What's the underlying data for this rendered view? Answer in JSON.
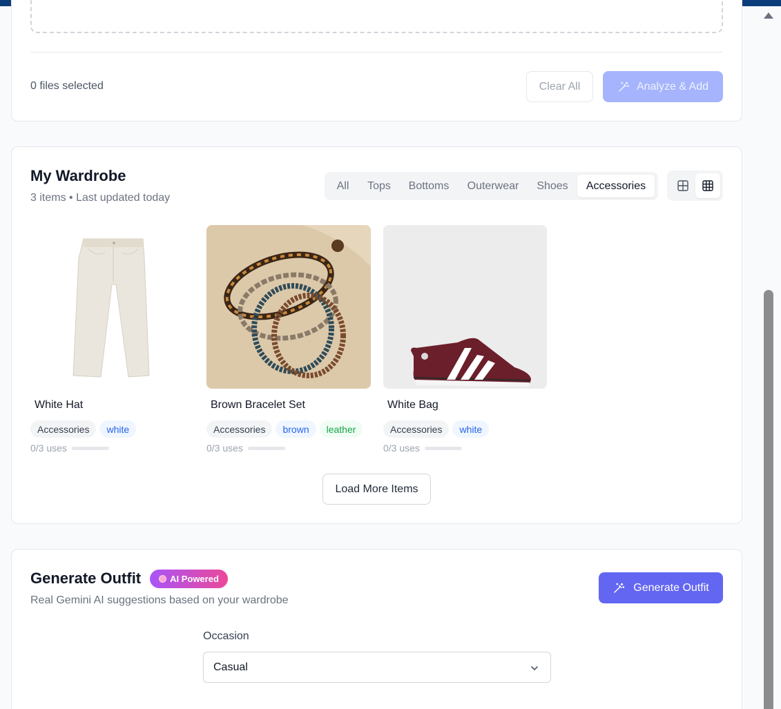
{
  "upload": {
    "files_selected": "0 files selected",
    "clear_label": "Clear All",
    "analyze_label": "Analyze & Add"
  },
  "wardrobe": {
    "title": "My Wardrobe",
    "subtitle": "3 items • Last updated today",
    "filters": [
      "All",
      "Tops",
      "Bottoms",
      "Outerwear",
      "Shoes",
      "Accessories"
    ],
    "active_filter": "Accessories",
    "view_modes": [
      "grid-large-icon",
      "grid-small-icon"
    ],
    "active_view": "grid-small-icon",
    "items": [
      {
        "name": "White Hat",
        "tags": [
          {
            "label": "Accessories",
            "kind": "category"
          },
          {
            "label": "white",
            "kind": "color"
          }
        ],
        "uses": "0/3 uses",
        "usage_fraction": 0,
        "image": "white-pants-image"
      },
      {
        "name": "Brown Bracelet Set",
        "tags": [
          {
            "label": "Accessories",
            "kind": "category"
          },
          {
            "label": "brown",
            "kind": "color"
          },
          {
            "label": "leather",
            "kind": "material"
          }
        ],
        "uses": "0/3 uses",
        "usage_fraction": 0,
        "image": "bracelets-image"
      },
      {
        "name": "White Bag",
        "tags": [
          {
            "label": "Accessories",
            "kind": "category"
          },
          {
            "label": "white",
            "kind": "color"
          }
        ],
        "uses": "0/3 uses",
        "usage_fraction": 0,
        "image": "sneaker-image"
      }
    ],
    "load_more_label": "Load More Items"
  },
  "generator": {
    "title": "Generate Outfit",
    "badge": "AI Powered",
    "subtitle": "Real Gemini AI suggestions based on your wardrobe",
    "button_label": "Generate Outfit",
    "occasion_label": "Occasion",
    "occasion_value": "Casual"
  },
  "colors": {
    "primary": "#6366f1",
    "primary_disabled": "#a5b4fc",
    "badge_gradient_start": "#a855f7",
    "badge_gradient_end": "#ec4899",
    "topbar": "#0b3d7a"
  }
}
